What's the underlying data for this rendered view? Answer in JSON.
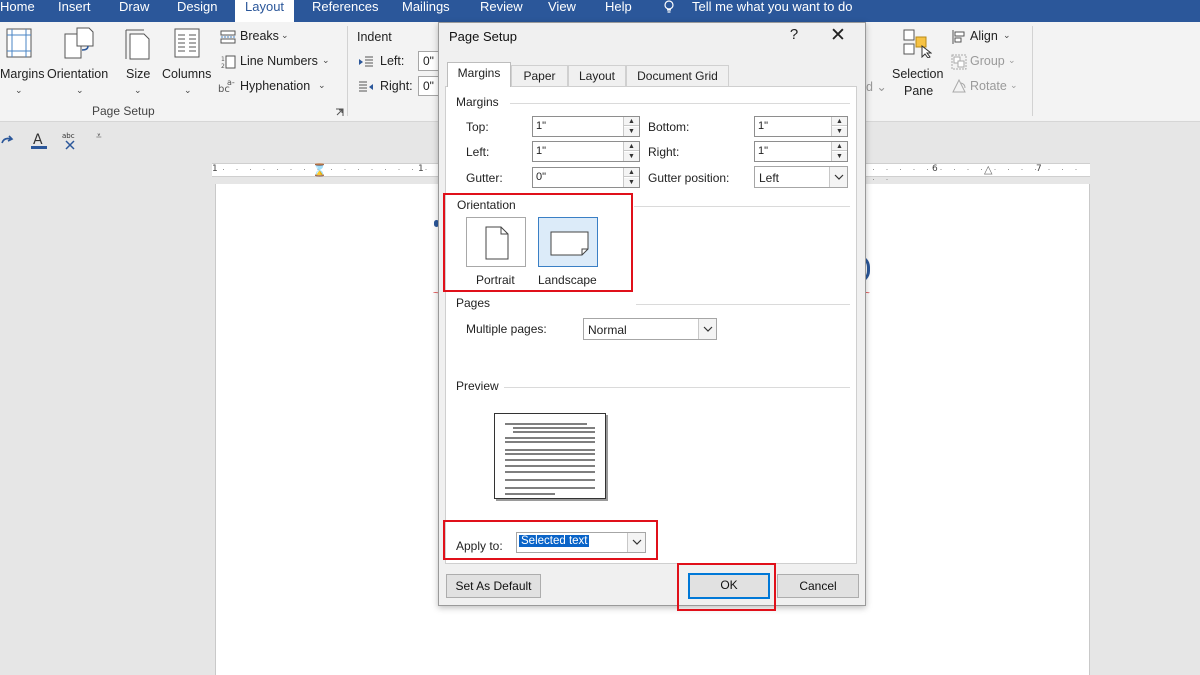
{
  "ribbon_tabs": [
    "Home",
    "Insert",
    "Draw",
    "Design",
    "Layout",
    "References",
    "Mailings",
    "Review",
    "View",
    "Help"
  ],
  "tell_me": "Tell me what you want to do",
  "ribbon": {
    "margins": "Margins",
    "orientation": "Orientation",
    "size": "Size",
    "columns": "Columns",
    "breaks": "Breaks",
    "line_numbers": "Line Numbers",
    "hyphenation": "Hyphenation",
    "page_setup_group": "Page Setup",
    "indent": "Indent",
    "indent_left": "Left:",
    "indent_left_value": "0\"",
    "indent_right": "Right:",
    "indent_right_value": "0\"",
    "selection_pane_1": "Selection",
    "selection_pane_2": "Pane",
    "align": "Align",
    "group": "Group",
    "rotate": "Rotate"
  },
  "ruler": [
    "1",
    "1",
    "6",
    "7"
  ],
  "dialog": {
    "title": "Page Setup",
    "help": "?",
    "tabs": [
      "Margins",
      "Paper",
      "Layout",
      "Document Grid"
    ],
    "margins_section": "Margins",
    "top_label": "Top:",
    "top_value": "1\"",
    "bottom_label": "Bottom:",
    "bottom_value": "1\"",
    "left_label": "Left:",
    "left_value": "1\"",
    "right_label": "Right:",
    "right_value": "1\"",
    "gutter_label": "Gutter:",
    "gutter_value": "0\"",
    "gutter_position_label": "Gutter position:",
    "gutter_position_value": "Left",
    "orientation_section": "Orientation",
    "portrait": "Portrait",
    "landscape": "Landscape",
    "selected_orientation": "Landscape",
    "pages_section": "Pages",
    "multiple_pages_label": "Multiple pages:",
    "multiple_pages_value": "Normal",
    "preview_section": "Preview",
    "apply_to_label": "Apply to:",
    "apply_to_value": "Selected text",
    "set_default": "Set As Default",
    "ok": "OK",
    "cancel": "Cancel"
  },
  "colors": {
    "ribbon_blue": "#2b579a",
    "highlight": "#e0101a",
    "selection": "#0a64c8"
  }
}
